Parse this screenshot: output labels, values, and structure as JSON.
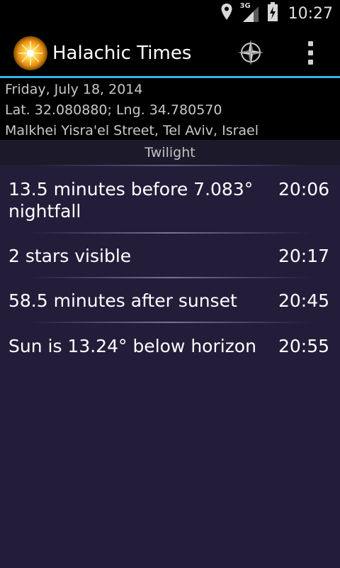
{
  "status_bar": {
    "time": "10:27",
    "network": "3G",
    "icons": [
      "location-pin-icon",
      "signal-3g-icon",
      "battery-charging-icon"
    ]
  },
  "action_bar": {
    "title": "Halachic Times",
    "logo_icon": "sun-logo-icon",
    "compass_icon": "compass-icon",
    "overflow_icon": "overflow-menu-icon",
    "accent_color": "#33b5e5"
  },
  "header": {
    "date": "Friday, July 18, 2014",
    "coordinates": "Lat. 32.080880; Lng. 34.780570",
    "address": "Malkhei Yisra'el Street, Tel Aviv, Israel"
  },
  "section": {
    "title": "Twilight"
  },
  "times": [
    {
      "label": "13.5 minutes before 7.083° nightfall",
      "time": "20:06"
    },
    {
      "label": "2 stars visible",
      "time": "20:17"
    },
    {
      "label": "58.5 minutes after sunset",
      "time": "20:45"
    },
    {
      "label": "Sun is 13.24° below horizon",
      "time": "20:55"
    }
  ]
}
